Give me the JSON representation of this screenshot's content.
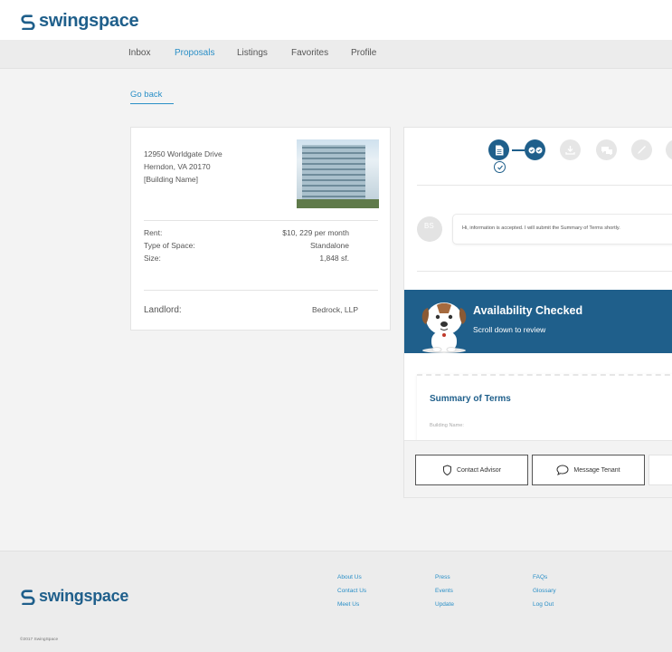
{
  "brand": {
    "name": "swingspace",
    "color": "#1f5f8b",
    "accent": "#2a8fc7"
  },
  "nav": {
    "items": [
      {
        "label": "Inbox",
        "active": false
      },
      {
        "label": "Proposals",
        "active": true
      },
      {
        "label": "Listings",
        "active": false
      },
      {
        "label": "Favorites",
        "active": false
      },
      {
        "label": "Profile",
        "active": false
      }
    ]
  },
  "go_back": "Go back",
  "listing": {
    "address_line1": "12950 Worldgate Drive",
    "address_line2": "Herndon, VA 20170",
    "building_name": "[Building Name]",
    "rows": [
      {
        "label": "Rent:",
        "value": "$10, 229 per month"
      },
      {
        "label": "Type of Space:",
        "value": "Standalone"
      },
      {
        "label": "Size:",
        "value": "1,848 sf."
      }
    ],
    "landlord_label": "Landlord:",
    "landlord_value": "Bedrock, LLP"
  },
  "progress": {
    "steps": [
      {
        "icon": "document-icon",
        "status": "done"
      },
      {
        "icon": "availability-icon",
        "status": "done"
      },
      {
        "icon": "download-icon",
        "status": "pending"
      },
      {
        "icon": "chat-icon",
        "status": "pending"
      },
      {
        "icon": "pen-icon",
        "status": "pending"
      },
      {
        "icon": "step-icon",
        "status": "pending"
      }
    ]
  },
  "message": {
    "avatar_initials": "BS",
    "text": "Hi, information is accepted. I will submit the Summary of Terms shortly."
  },
  "banner": {
    "title": "Availability Checked",
    "subtitle": "Scroll down to review"
  },
  "summary": {
    "title": "Summary of Terms",
    "field_label": "Building Name:"
  },
  "buttons": {
    "contact_advisor": "Contact Advisor",
    "message_tenant": "Message Tenant"
  },
  "footer": {
    "col1": [
      "About Us",
      "Contact Us",
      "Meet Us"
    ],
    "col2": [
      "Press",
      "Events",
      "Update"
    ],
    "col3": [
      "FAQs",
      "Glossary",
      "Log Out"
    ],
    "copyright": "©2017 SwingSpace"
  }
}
